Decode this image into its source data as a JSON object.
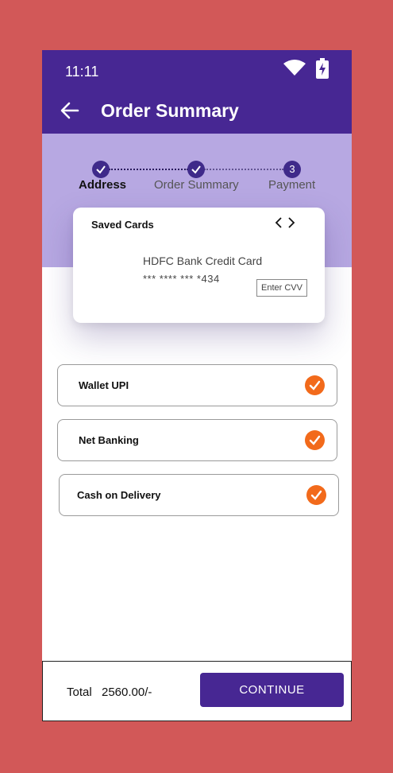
{
  "status_bar": {
    "time": "11:11",
    "wifi_icon": "wifi-icon",
    "battery_icon": "battery-charging-icon"
  },
  "app_bar": {
    "back_icon": "arrow-left-icon",
    "title": "Order Summary"
  },
  "stepper": {
    "steps": [
      {
        "label": "Address",
        "state": "done",
        "marker": ""
      },
      {
        "label": "Order Summary",
        "state": "done",
        "marker": ""
      },
      {
        "label": "Payment",
        "state": "current",
        "marker": "3"
      }
    ]
  },
  "saved_cards": {
    "title": "Saved Cards",
    "prev_icon": "chevron-left-icon",
    "next_icon": "chevron-right-icon",
    "bank": "HDFC Bank Credit Card",
    "number": "*** **** *** *434",
    "cvv_placeholder": "Enter CVV"
  },
  "payment_options": [
    {
      "label": "Wallet UPI",
      "checked": true
    },
    {
      "label": "Net Banking",
      "checked": true
    },
    {
      "label": "Cash on Delivery",
      "checked": true
    }
  ],
  "footer": {
    "total_label": "Total",
    "total_value": "2560.00/-",
    "continue_label": "CONTINUE"
  },
  "colors": {
    "primary": "#472793",
    "hero": "#b7a8e2",
    "accent": "#f26a1b",
    "background": "#d25858"
  }
}
